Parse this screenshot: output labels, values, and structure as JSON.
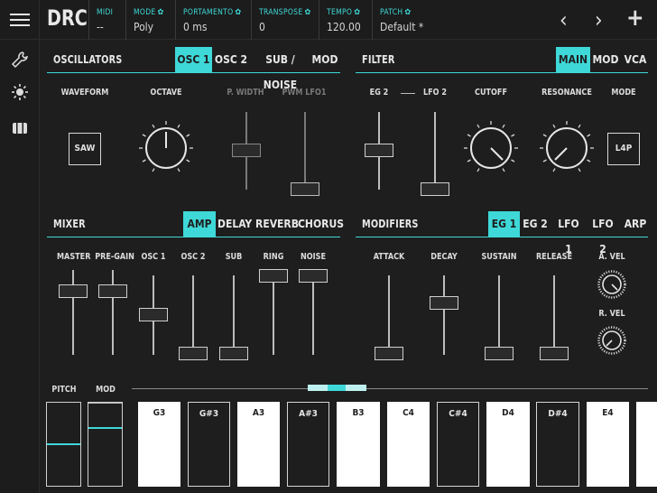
{
  "app": {
    "logo": "DRC"
  },
  "topbar": {
    "fields": [
      {
        "label": "MIDI",
        "value": "--",
        "gear": false
      },
      {
        "label": "MODE",
        "value": "Poly",
        "gear": true
      },
      {
        "label": "PORTAMENTO",
        "value": "0 ms",
        "gear": true
      },
      {
        "label": "TRANSPOSE",
        "value": "0",
        "gear": true
      },
      {
        "label": "TEMPO",
        "value": "120.00",
        "gear": true
      },
      {
        "label": "PATCH",
        "value": "Default *",
        "gear": true
      }
    ],
    "prev": "‹",
    "next": "›",
    "add": "+"
  },
  "sidebar": {
    "icons": [
      "wrench-icon",
      "brightness-icon",
      "cassette-icon"
    ]
  },
  "oscillators": {
    "title": "OSCILLATORS",
    "tabs": [
      "OSC 1",
      "OSC 2",
      "SUB / NOISE",
      "MOD"
    ],
    "active_tab": 0,
    "labels": {
      "waveform": "WAVEFORM",
      "octave": "OCTAVE",
      "pwidth": "P. WIDTH",
      "pwmlfo": "PWM LFO1"
    },
    "waveform_button": "SAW",
    "pwidth_level": 0.55,
    "pwmlfo_level": 0.0
  },
  "filter": {
    "title": "FILTER",
    "tabs": [
      "MAIN",
      "MOD",
      "VCA"
    ],
    "active_tab": 0,
    "labels": {
      "eg2": "EG 2",
      "lfo2": "LFO 2",
      "cutoff": "CUTOFF",
      "resonance": "RESONANCE",
      "mode": "MODE"
    },
    "mode_button": "L4P",
    "eg2_level": 0.5,
    "lfo2_level": 0.0
  },
  "mixer": {
    "title": "MIXER",
    "tabs": [
      "AMP",
      "DELAY",
      "REVERB",
      "CHORUS"
    ],
    "active_tab": 0,
    "sliders": [
      {
        "label": "MASTER",
        "level": 0.75
      },
      {
        "label": "PRE-GAIN",
        "level": 0.75
      },
      {
        "label": "OSC 1",
        "level": 0.5
      },
      {
        "label": "OSC 2",
        "level": 0.0
      },
      {
        "label": "SUB",
        "level": 0.0
      },
      {
        "label": "RING",
        "level": 1.0
      },
      {
        "label": "NOISE",
        "level": 1.0
      }
    ]
  },
  "modifiers": {
    "title": "MODIFIERS",
    "tabs": [
      "EG 1",
      "EG 2",
      "LFO 1",
      "LFO 2",
      "ARP"
    ],
    "active_tab": 0,
    "sliders": [
      {
        "label": "ATTACK",
        "level": 0.0
      },
      {
        "label": "DECAY",
        "level": 0.65
      },
      {
        "label": "SUSTAIN",
        "level": 0.0
      },
      {
        "label": "RELEASE",
        "level": 0.0
      }
    ],
    "knob_labels": {
      "avel": "A. VEL",
      "rvel": "R. VEL"
    }
  },
  "keyboard": {
    "pitch_label": "PITCH",
    "mod_label": "MOD",
    "keys": [
      {
        "note": "G3",
        "type": "white"
      },
      {
        "note": "G#3",
        "type": "black"
      },
      {
        "note": "A3",
        "type": "white"
      },
      {
        "note": "A#3",
        "type": "black"
      },
      {
        "note": "B3",
        "type": "white"
      },
      {
        "note": "C4",
        "type": "white"
      },
      {
        "note": "C#4",
        "type": "black"
      },
      {
        "note": "D4",
        "type": "white"
      },
      {
        "note": "D#4",
        "type": "black"
      },
      {
        "note": "E4",
        "type": "white"
      }
    ]
  },
  "colors": {
    "accent": "#3fd8d8",
    "background": "#1e1e1e"
  }
}
